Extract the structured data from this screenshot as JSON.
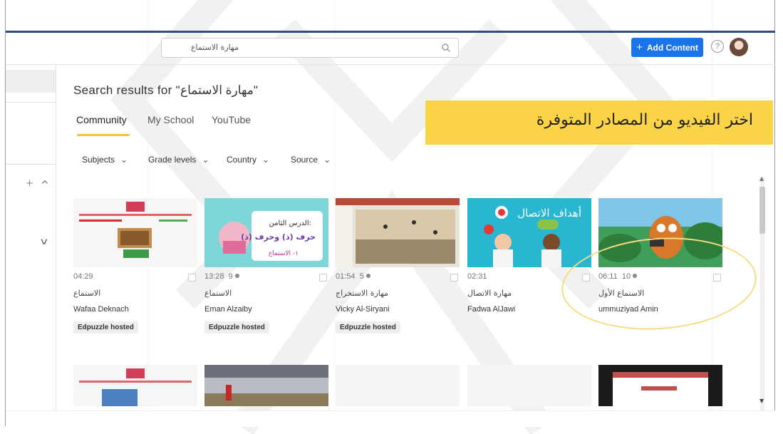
{
  "search": {
    "query": "مهارة الاستماع"
  },
  "header": {
    "add_content_label": "Add Content",
    "add_icon": "+",
    "help_glyph": "?"
  },
  "results": {
    "title": "Search results for \"مهارة الاستماع\""
  },
  "tabs": [
    {
      "label": "Community",
      "active": true
    },
    {
      "label": "My School",
      "active": false
    },
    {
      "label": "YouTube",
      "active": false
    }
  ],
  "banner": {
    "text": "اختر الفيديو من المصادر المتوفرة",
    "color": "#fbd347"
  },
  "filters": [
    {
      "label": "Subjects"
    },
    {
      "label": "Grade levels"
    },
    {
      "label": "Country"
    },
    {
      "label": "Source"
    }
  ],
  "videos": [
    {
      "duration": "04:29",
      "count": "",
      "title": "الاستماع",
      "author": "Wafaa Deknach",
      "badge": "Edpuzzle hosted"
    },
    {
      "duration": "13:28",
      "count": "9",
      "title": "الاستماع",
      "author": "Eman Alzaiby",
      "badge": "Edpuzzle hosted",
      "thumb_text_1": "الدرس الثامن:",
      "thumb_text_2": "حرف (ذ) وحرف (ذ)",
      "thumb_text_3": "١- الاستماع"
    },
    {
      "duration": "01:54",
      "count": "5",
      "title": "مهارة الاستخراج",
      "author": "Vicky Al-Siryani",
      "badge": "Edpuzzle hosted"
    },
    {
      "duration": "02:31",
      "count": "",
      "title": "مهارة الاتصال",
      "author": "Fadwa AlJawi",
      "badge": "",
      "thumb_text_1": "أهداف الاتصال"
    },
    {
      "duration": "06:11",
      "count": "10",
      "title": "الاستماع الأول",
      "author": "ummuziyad Amin",
      "badge": ""
    }
  ],
  "colors": {
    "accent_blue": "#1a73e8",
    "tab_underline": "#f6c33b",
    "rule": "#2e4b85"
  }
}
